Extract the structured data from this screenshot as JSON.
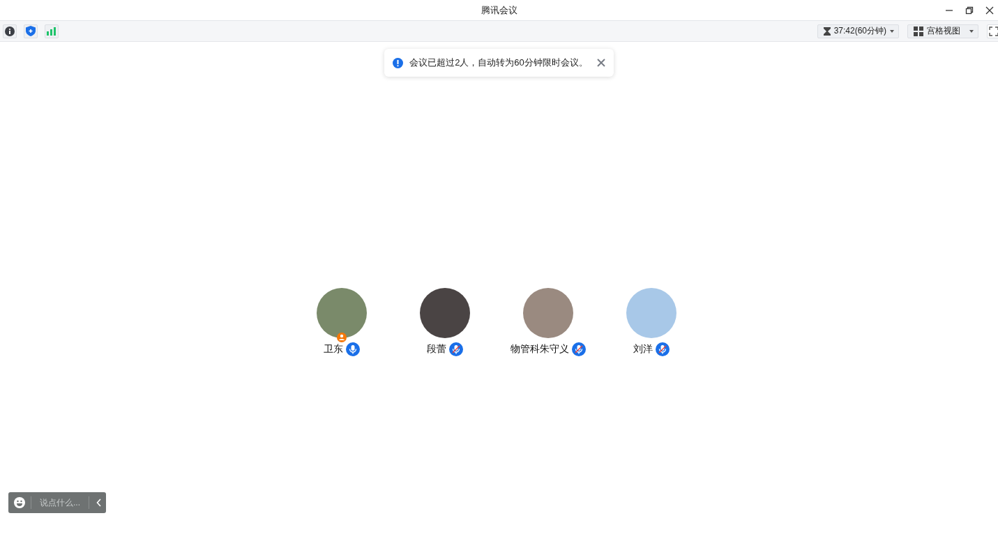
{
  "window": {
    "title": "腾讯会议"
  },
  "toolbar": {
    "timer": "37:42(60分钟)",
    "view": "宫格视图"
  },
  "notice": {
    "text": "会议已超过2人，自动转为60分钟限时会议。"
  },
  "participants": [
    {
      "name": "卫东",
      "muted": false,
      "host": true,
      "color": "#7a8a6a"
    },
    {
      "name": "段蕾",
      "muted": true,
      "host": false,
      "color": "#4a4444"
    },
    {
      "name": "物管科朱守义",
      "muted": true,
      "host": false,
      "color": "#9a8a80"
    },
    {
      "name": "刘洋",
      "muted": true,
      "host": false,
      "color": "#a8c8e8"
    }
  ],
  "chat": {
    "placeholder": "说点什么..."
  }
}
